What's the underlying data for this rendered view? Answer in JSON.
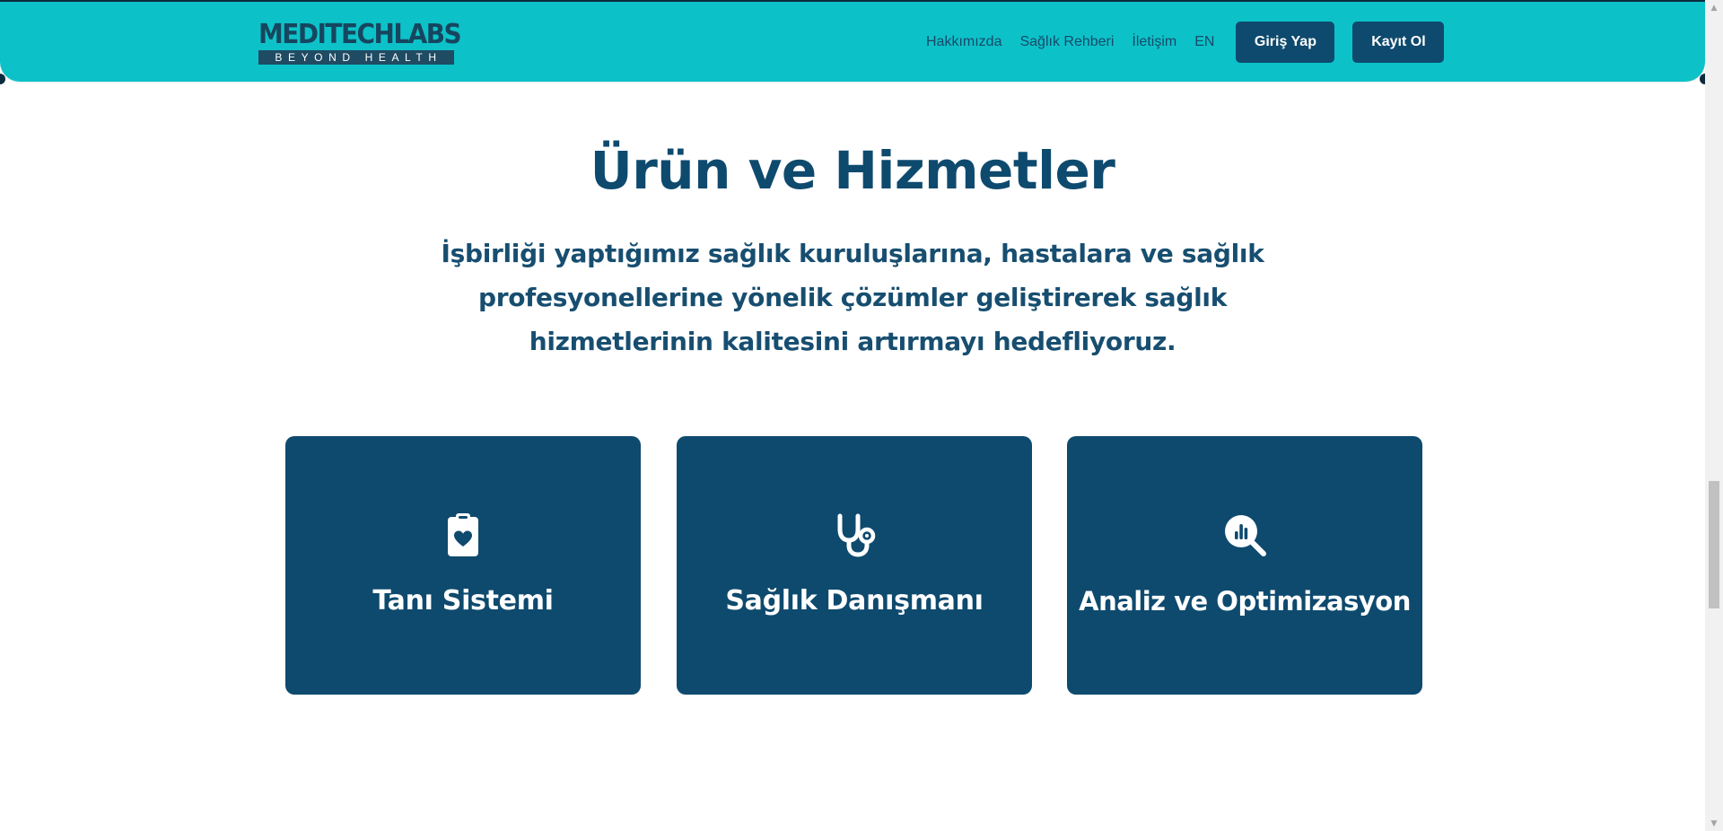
{
  "header": {
    "logo": {
      "name": "MEDITECHLABS",
      "tagline": "BEYOND HEALTH"
    },
    "nav": [
      {
        "label": "Hakkımızda"
      },
      {
        "label": "Sağlık Rehberi"
      },
      {
        "label": "İletişim"
      },
      {
        "label": "EN"
      }
    ],
    "login_label": "Giriş Yap",
    "register_label": "Kayıt Ol"
  },
  "main": {
    "title": "Ürün ve Hizmetler",
    "subtitle": "İşbirliği yaptığımız sağlık kuruluşlarına, hastalara ve sağlık profesyonellerine yönelik çözümler geliştirerek sağlık hizmetlerinin kalitesini artırmayı hedefliyoruz.",
    "cards": [
      {
        "icon": "clipboard-heart-icon",
        "title": "Tanı Sistemi"
      },
      {
        "icon": "stethoscope-icon",
        "title": "Sağlık Danışmanı"
      },
      {
        "icon": "magnifier-chart-icon",
        "title": "Analiz ve Optimizasyon"
      }
    ]
  },
  "colors": {
    "header_bg": "#0cc2c8",
    "primary": "#0e4a6e",
    "text_on_primary": "#ffffff",
    "page_bg": "#ffffff"
  }
}
